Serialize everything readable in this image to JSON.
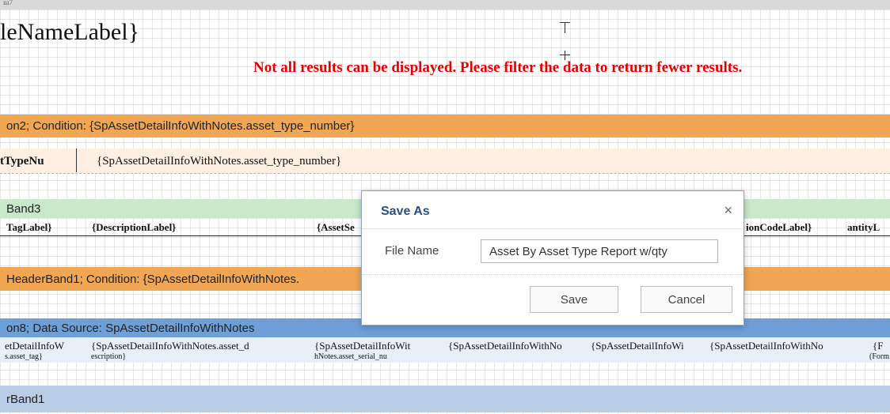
{
  "topbar": {
    "text": "ııı7"
  },
  "report": {
    "title_label": "leNameLabel}",
    "warning": "Not all results can be displayed. Please filter the data to return fewer results."
  },
  "bands": {
    "group_header_2": "on2; Condition: {SpAssetDetailInfoWithNotes.asset_type_number}",
    "group_row_label": "tTypeNu",
    "group_row_value": "{SpAssetDetailInfoWithNotes.asset_type_number}",
    "header_band_3": "Band3",
    "group_header_1": "HeaderBand1; Condition: {SpAssetDetailInfoWithNotes.",
    "data_band_8": "on8; Data Source: SpAssetDetailInfoWithNotes",
    "footer_band_1": "rBand1"
  },
  "column_headers": [
    "TagLabel}",
    "{DescriptionLabel}",
    "{AssetSe",
    "ionCodeLabel}",
    "antityL"
  ],
  "data_row_cells": [
    "etDetailInfoW",
    "{SpAssetDetailInfoWithNotes.asset_d",
    "{SpAssetDetailInfoWit",
    "{SpAssetDetailInfoWithNo",
    "{SpAssetDetailInfoWi",
    "{SpAssetDetailInfoWithNo",
    "{F"
  ],
  "data_row_sub": [
    "s.asset_tag}",
    "escription}",
    "hNotes.asset_serial_nu",
    "(Form"
  ],
  "dialog": {
    "title": "Save As",
    "close_glyph": "×",
    "file_name_label": "File Name",
    "file_name_value": "Asset By Asset Type Report w/qty",
    "save_label": "Save",
    "cancel_label": "Cancel",
    "accent_color": "#2a4f8a"
  }
}
